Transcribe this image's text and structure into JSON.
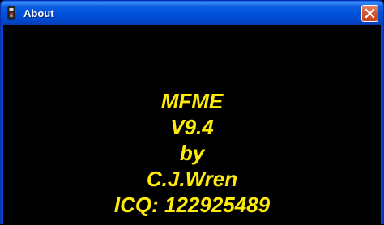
{
  "window": {
    "title": "About",
    "app_icon": "slot-machine-icon",
    "close_icon": "close-icon"
  },
  "about": {
    "lines": [
      "MFME",
      "V9.4",
      "by",
      "C.J.Wren",
      "ICQ: 122925489"
    ]
  },
  "colors": {
    "text": "#ffeb0a",
    "background": "#000000",
    "titlebar": "#0052dc",
    "close_button": "#d65a37"
  }
}
